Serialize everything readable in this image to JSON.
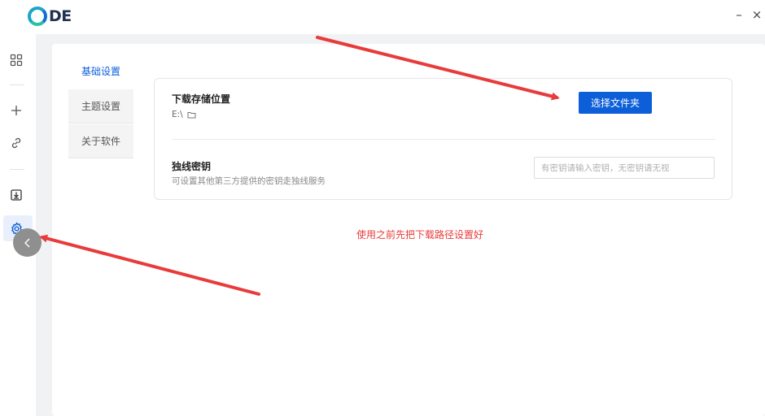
{
  "app": {
    "logo_text": "DE"
  },
  "window": {
    "minimize_glyph": "–",
    "close_glyph": "×"
  },
  "sidebar": {
    "icons": [
      "grid-icon",
      "plus-icon",
      "link-icon",
      "download-icon",
      "gear-icon"
    ]
  },
  "settings": {
    "tabs": [
      {
        "label": "基础设置",
        "active": true
      },
      {
        "label": "主题设置",
        "active": false
      },
      {
        "label": "关于软件",
        "active": false
      }
    ],
    "download": {
      "title": "下载存储位置",
      "path": "E:\\",
      "button": "选择文件夹"
    },
    "key": {
      "title": "独线密钥",
      "desc": "可设置其他第三方提供的密钥走独线服务",
      "placeholder": "有密钥请输入密钥，无密钥请无视"
    },
    "note": "使用之前先把下载路径设置好"
  },
  "colors": {
    "accent": "#0d5fd9",
    "annotation": "#e83b3b"
  }
}
